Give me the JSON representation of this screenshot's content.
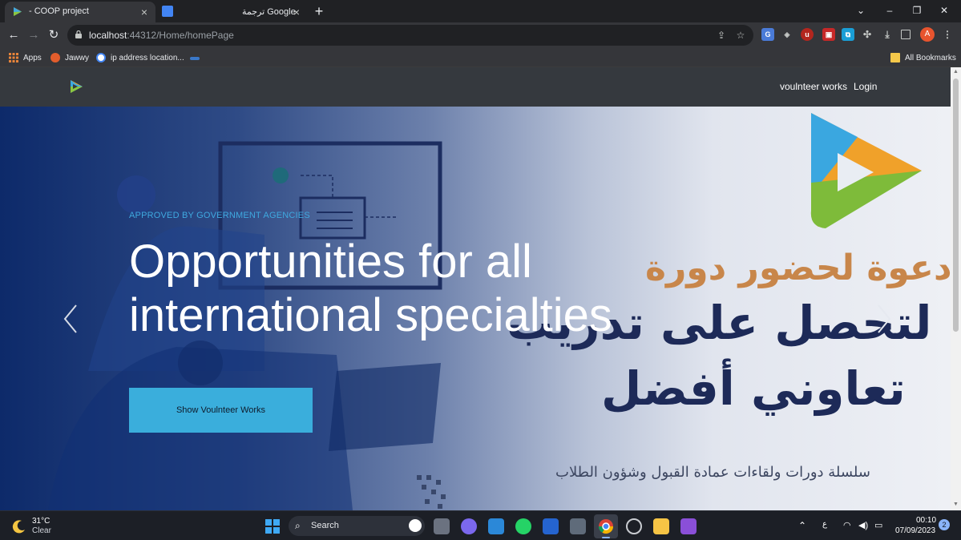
{
  "browser": {
    "tabs": [
      {
        "title": "- COOP project",
        "active": true
      },
      {
        "title": "Google ترجمة",
        "active": false
      }
    ],
    "url_host": "localhost",
    "url_rest": ":44312/Home/homePage",
    "bookmarks": [
      {
        "label": "Apps",
        "icon": "apps-grid-icon"
      },
      {
        "label": "Jawwy",
        "icon": "jawwy-icon"
      },
      {
        "label": "ip address location...",
        "icon": "google-icon"
      }
    ],
    "all_bookmarks_label": "All Bookmarks",
    "profile_initial": "A"
  },
  "site": {
    "nav_links": [
      "voulnteer works",
      "Login"
    ],
    "hero": {
      "eyebrow": "APPROVED BY GOVERNMENT AGENCIES",
      "headline_line1": "Opportunities for all",
      "headline_line2": "international specialties",
      "cta_label": "Show Voulnteer Works",
      "arabic_line1": "دعوة لحضور دورة",
      "arabic_line2": "لتحصل على تدريب",
      "arabic_line3": "تعاوني أفضل",
      "arabic_line4": "سلسلة دورات ولقاءات عمادة القبول وشؤون الطلاب"
    }
  },
  "taskbar": {
    "weather_temp": "31°C",
    "weather_desc": "Clear",
    "search_label": "Search",
    "lang": "ع",
    "time": "00:10",
    "date": "07/09/2023",
    "notifications": "2"
  }
}
